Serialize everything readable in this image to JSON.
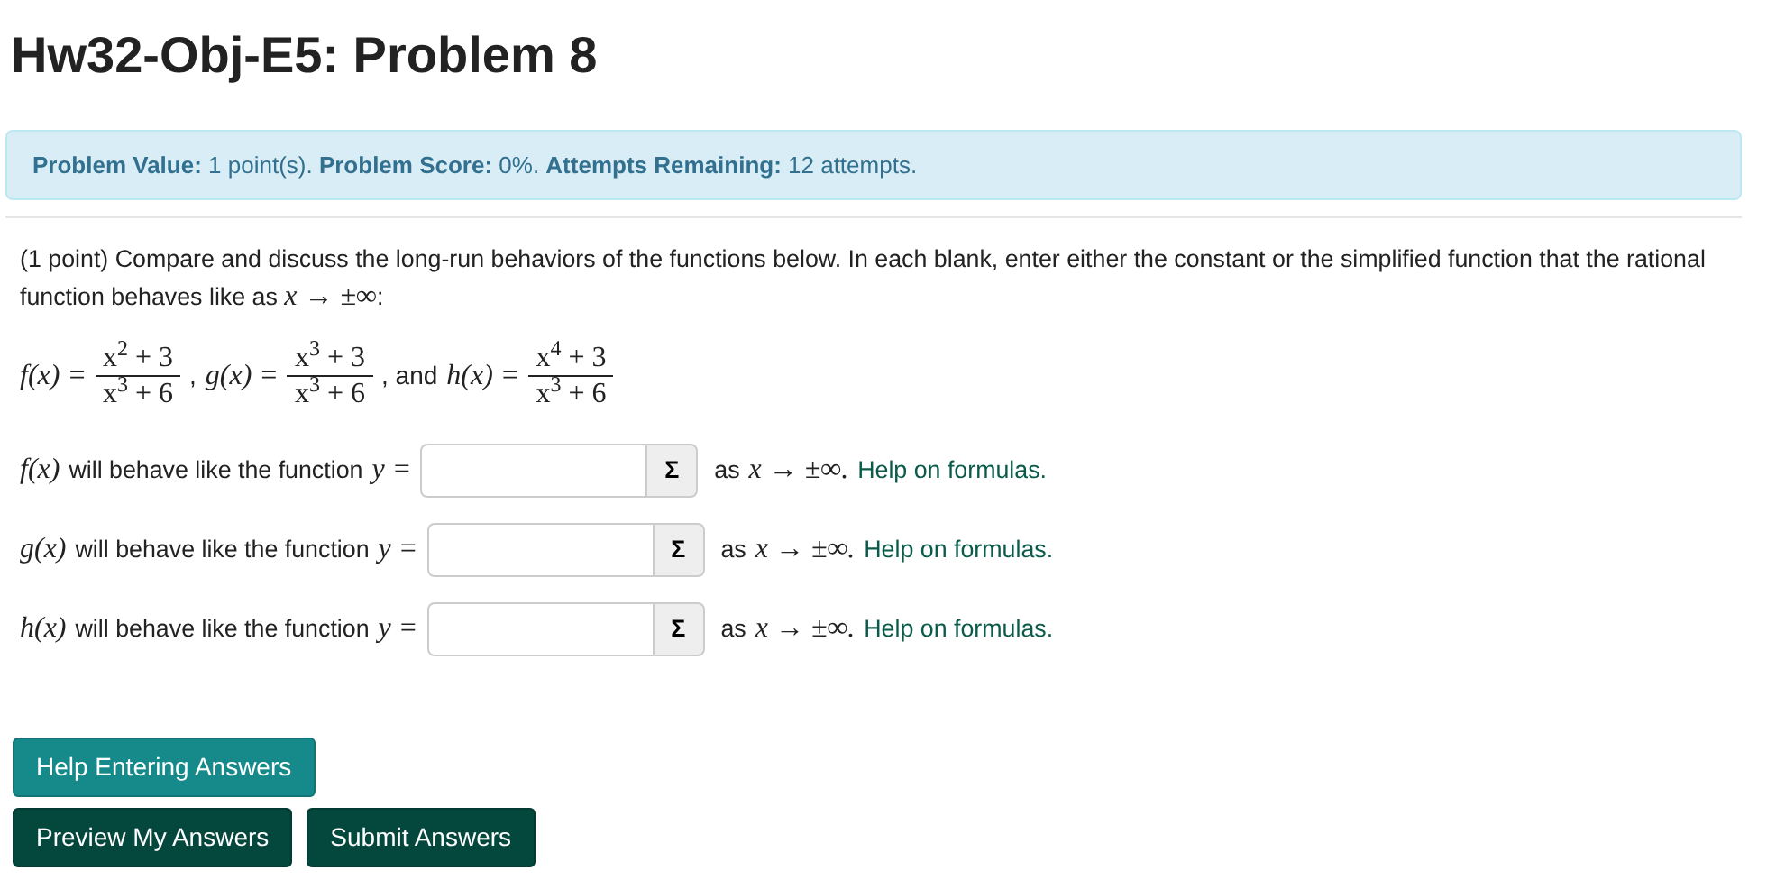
{
  "title": "Hw32-Obj-E5: Problem 8",
  "status": "**Problem Value:** 1 point(s). **Problem Score:** 0%. **Attempts Remaining:** 12 attempts.",
  "intro": {
    "text": "(1 point) Compare and discuss the long-run behaviors of the functions below. In each blank, enter either the constant or the simplified function that the rational function behaves like as ",
    "math": "x → ±∞",
    "end": ":"
  },
  "functions": [
    {
      "label": "f(x) =",
      "numerator": "x$^{2}$ + 3",
      "denominator": "x$^{3}$ + 6"
    },
    {
      "lead": ",",
      "label": "g(x) =",
      "numerator": "x$^{3}$ + 3",
      "denominator": "x$^{3}$ + 6"
    },
    {
      "lead": ", and",
      "label": "h(x) =",
      "numerator": "x$^{4}$ + 3",
      "denominator": "x$^{3}$ + 6"
    }
  ],
  "answers": [
    {
      "var": "f(x)",
      "text": "will behave like the function",
      "y_label": "y =",
      "button": "Σ",
      "after": "as",
      "limit": "x → ±∞.",
      "link": "Help on formulas."
    },
    {
      "var": "g(x)",
      "text": "will behave like the function",
      "y_label": "y =",
      "button": "Σ",
      "after": "as",
      "limit": "x → ±∞.",
      "link": "Help on formulas."
    },
    {
      "var": "h(x)",
      "text": "will behave like the function",
      "y_label": "y =",
      "button": "Σ",
      "after": "as",
      "limit": "x → ±∞.",
      "link": "Help on formulas."
    }
  ],
  "help_button": "Help Entering Answers",
  "buttons": [
    "Preview My Answers",
    "Submit Answers"
  ]
}
